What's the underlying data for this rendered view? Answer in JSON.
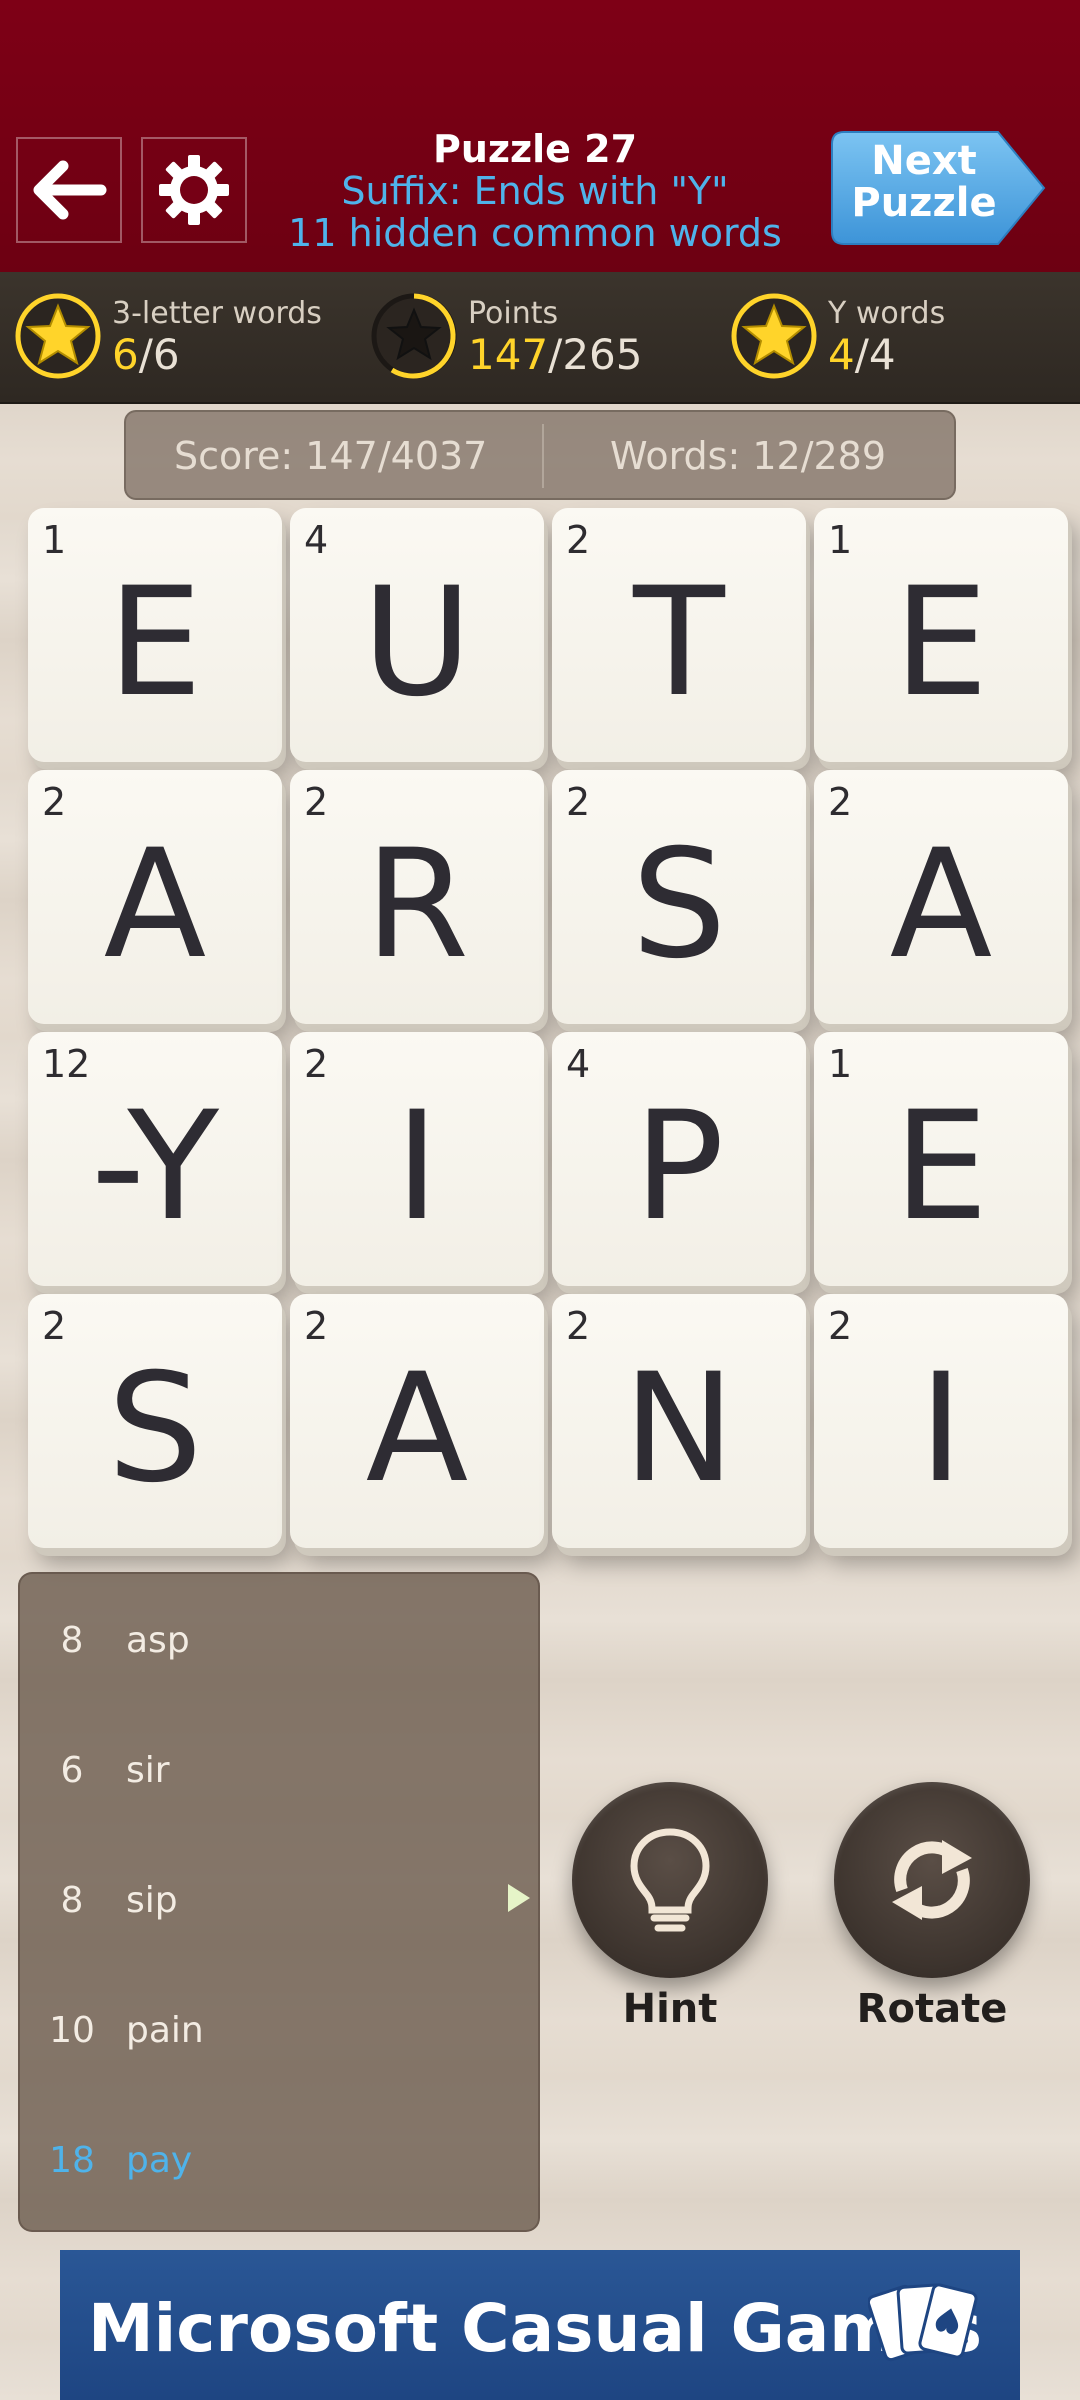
{
  "header": {
    "title": "Puzzle 27",
    "subtitle1": "Suffix: Ends with \"Y\"",
    "subtitle2": "11 hidden common words",
    "next_label_line1": "Next",
    "next_label_line2": "Puzzle"
  },
  "stats": [
    {
      "label": "3-letter words",
      "current": "6",
      "total": "/6",
      "star": "filled"
    },
    {
      "label": "Points",
      "current": "147",
      "total": "/265",
      "star": "partial"
    },
    {
      "label": "Y words",
      "current": "4",
      "total": "/4",
      "star": "filled"
    }
  ],
  "scorebar": {
    "score": "Score: 147/4037",
    "words": "Words: 12/289"
  },
  "board": [
    {
      "letter": "E",
      "points": "1"
    },
    {
      "letter": "U",
      "points": "4"
    },
    {
      "letter": "T",
      "points": "2"
    },
    {
      "letter": "E",
      "points": "1"
    },
    {
      "letter": "A",
      "points": "2"
    },
    {
      "letter": "R",
      "points": "2"
    },
    {
      "letter": "S",
      "points": "2"
    },
    {
      "letter": "A",
      "points": "2"
    },
    {
      "letter": "-Y",
      "points": "12"
    },
    {
      "letter": "I",
      "points": "2"
    },
    {
      "letter": "P",
      "points": "4"
    },
    {
      "letter": "E",
      "points": "1"
    },
    {
      "letter": "S",
      "points": "2"
    },
    {
      "letter": "A",
      "points": "2"
    },
    {
      "letter": "N",
      "points": "2"
    },
    {
      "letter": "I",
      "points": "2"
    }
  ],
  "words": [
    {
      "points": "8",
      "word": "asp"
    },
    {
      "points": "6",
      "word": "sir"
    },
    {
      "points": "8",
      "word": "sip"
    },
    {
      "points": "10",
      "word": "pain"
    },
    {
      "points": "18",
      "word": "pay"
    }
  ],
  "buttons": {
    "hint": "Hint",
    "rotate": "Rotate"
  },
  "ad": {
    "text": "Microsoft Casual Games"
  },
  "colors": {
    "header_bg": "#7e0016",
    "accent_blue": "#4fb3ea",
    "stat_yellow": "#ffd42a"
  }
}
